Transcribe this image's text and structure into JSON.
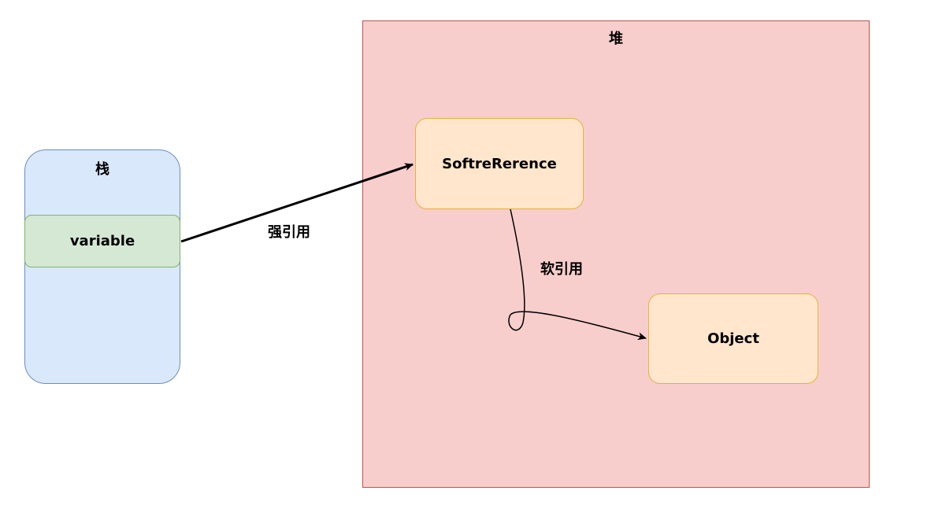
{
  "stack": {
    "title": "栈",
    "variable_label": "variable"
  },
  "heap": {
    "title": "堆",
    "soft_reference_label": "SoftreRerence",
    "object_label": "Object"
  },
  "edges": {
    "strong_ref_label": "强引用",
    "soft_ref_label": "软引用"
  },
  "colors": {
    "stack_fill": "#dae8fc",
    "stack_stroke": "#6c8ebf",
    "variable_fill": "#d5e8d4",
    "variable_stroke": "#82b366",
    "heap_fill": "#f8cecc",
    "heap_stroke": "#b85450",
    "node_fill": "#ffe6cc",
    "node_stroke": "#e2b340"
  }
}
